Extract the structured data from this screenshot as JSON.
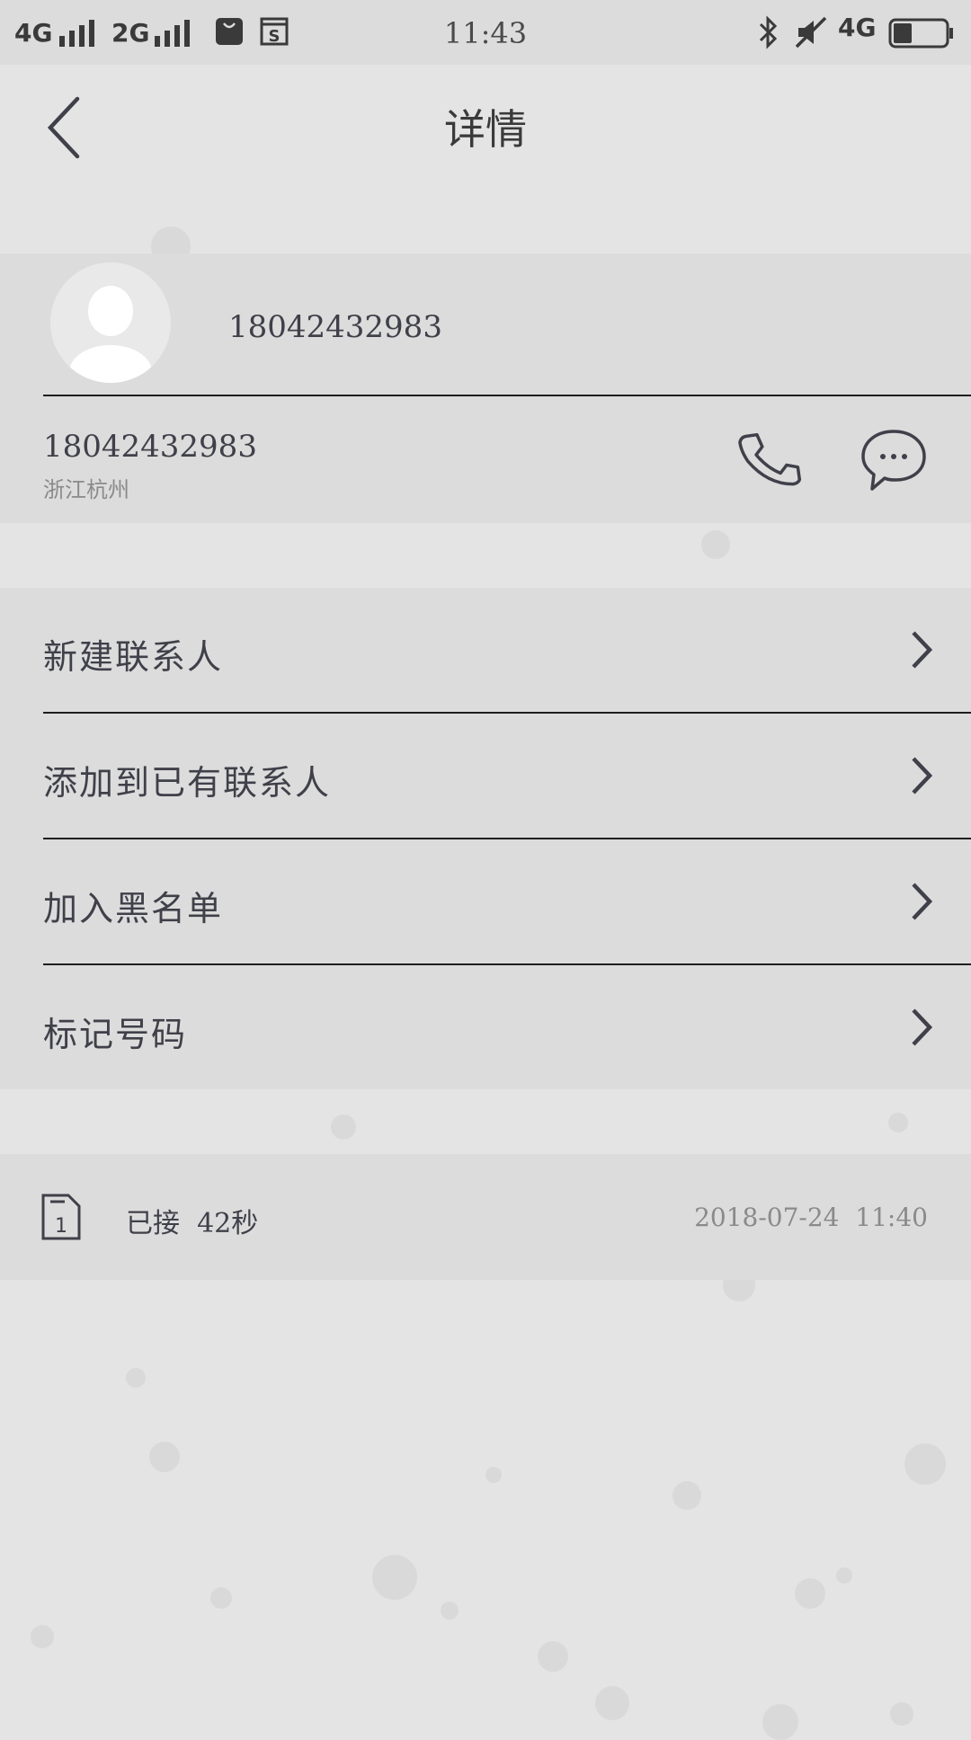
{
  "status_bar": {
    "network_1": "4G",
    "network_2": "2G",
    "time": "11:43",
    "network_3": "4G",
    "battery_level_fraction": 0.35,
    "icons": [
      "signal-icon",
      "signal-icon",
      "shopping-bag-icon",
      "s-app-icon",
      "bluetooth-icon",
      "mute-icon",
      "battery-icon"
    ]
  },
  "header": {
    "title": "详情",
    "back_icon": "chevron-left-icon"
  },
  "contact": {
    "display_name": "18042432983",
    "phone_number": "18042432983",
    "location": "浙江杭州",
    "call_icon": "phone-icon",
    "message_icon": "chat-bubble-icon"
  },
  "actions": [
    {
      "label": "新建联系人"
    },
    {
      "label": "添加到已有联系人"
    },
    {
      "label": "加入黑名单"
    },
    {
      "label": "标记号码"
    }
  ],
  "call_log": {
    "sim_slot": "1",
    "status": "已接  42秒",
    "timestamp": "2018-07-24  11:40"
  },
  "colors": {
    "background": "#e4e4e4",
    "card": "#dcdcdc",
    "text": "#3f4049",
    "secondary_text": "#8a8a8a",
    "divider": "#1e1e1e"
  }
}
